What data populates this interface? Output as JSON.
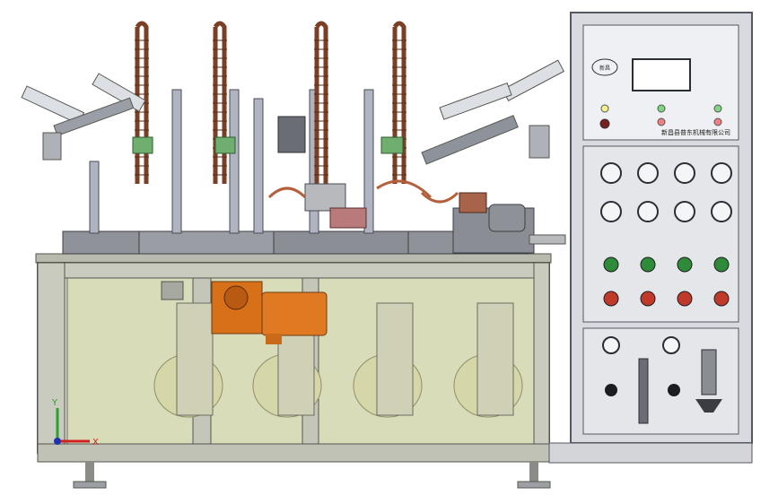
{
  "viewport": {
    "bg": "#ffffff"
  },
  "cabinet": {
    "logo_text": "新昌",
    "company_name": "新昌县普东机械有限公司",
    "gauges_count": 8,
    "indicator_colors": [
      "#f5f08c",
      "#7fd67f",
      "#7fd67f",
      "#f08080",
      "#f08080"
    ],
    "knob_colors": [
      "#2e8b3a",
      "#2e8b3a",
      "#2e8b3a",
      "#2e8b3a",
      "#c0392b",
      "#c0392b",
      "#c0392b",
      "#c0392b"
    ]
  },
  "axes_triad": {
    "x_label": "X",
    "y_label": "Y"
  },
  "colors": {
    "frame": "#c9cbbf",
    "frame_edge": "#6b6d62",
    "glass": "#d5d8b4",
    "cabinet_face": "#e6e8ec",
    "cabinet_edge": "#545861",
    "copper": "#d8701a",
    "coil": "#8b4a2b",
    "green_block": "#6fae6f"
  }
}
